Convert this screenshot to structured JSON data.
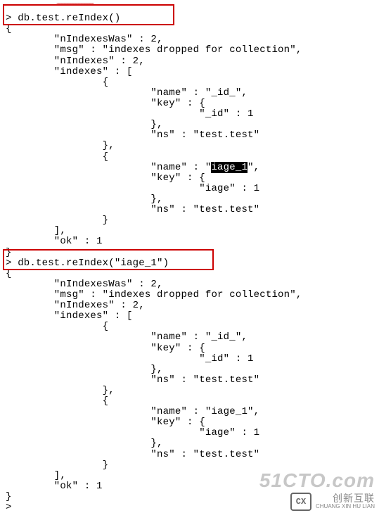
{
  "command1": "> db.test.reIndex()",
  "result1": {
    "open": "{",
    "nIndexesWas": "        \"nIndexesWas\" : 2,",
    "msg": "        \"msg\" : \"indexes dropped for collection\",",
    "nIndexes": "        \"nIndexes\" : 2,",
    "indexesOpen": "        \"indexes\" : [",
    "idx1open": "                {",
    "idx1name": "                        \"name\" : \"_id_\",",
    "idx1keyopen": "                        \"key\" : {",
    "idx1keyval": "                                \"_id\" : 1",
    "idx1keyclose": "                        },",
    "idx1ns": "                        \"ns\" : \"test.test\"",
    "idx1close": "                },",
    "idx2open": "                {",
    "idx2name_pre": "                        \"name\" : \"",
    "idx2name_sel": "iage_1",
    "idx2name_post": "\",",
    "idx2keyopen": "                        \"key\" : {",
    "idx2keyval": "                                \"iage\" : 1",
    "idx2keyclose": "                        },",
    "idx2ns": "                        \"ns\" : \"test.test\"",
    "idx2close": "                }",
    "indexesClose": "        ],",
    "ok": "        \"ok\" : 1",
    "close": "}"
  },
  "command2": "> db.test.reIndex(\"iage_1\")",
  "result2": {
    "open": "{",
    "nIndexesWas": "        \"nIndexesWas\" : 2,",
    "msg": "        \"msg\" : \"indexes dropped for collection\",",
    "nIndexes": "        \"nIndexes\" : 2,",
    "indexesOpen": "        \"indexes\" : [",
    "idx1open": "                {",
    "idx1name": "                        \"name\" : \"_id_\",",
    "idx1keyopen": "                        \"key\" : {",
    "idx1keyval": "                                \"_id\" : 1",
    "idx1keyclose": "                        },",
    "idx1ns": "                        \"ns\" : \"test.test\"",
    "idx1close": "                },",
    "idx2open": "                {",
    "idx2name": "                        \"name\" : \"iage_1\",",
    "idx2keyopen": "                        \"key\" : {",
    "idx2keyval": "                                \"iage\" : 1",
    "idx2keyclose": "                        },",
    "idx2ns": "                        \"ns\" : \"test.test\"",
    "idx2close": "                }",
    "indexesClose": "        ],",
    "ok": "        \"ok\" : 1",
    "close": "}"
  },
  "prompt": ">",
  "watermark": {
    "cto": "51CTO.com",
    "brand": "创新互联",
    "brand_en": "CHUANG XIN HU LIAN",
    "logo": "CX"
  },
  "squiggle": "~~~~~~~~~~~~~"
}
